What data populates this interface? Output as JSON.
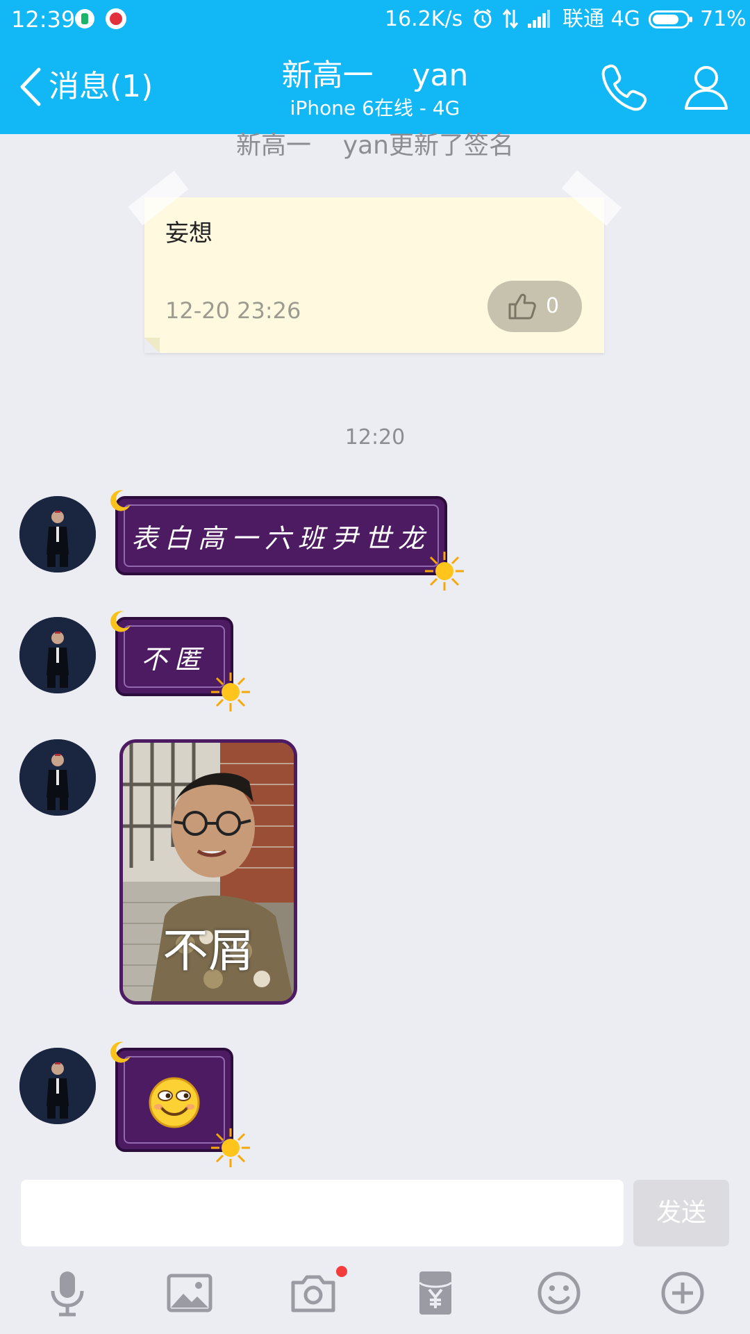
{
  "status_bar": {
    "time": "12:39",
    "speed": "16.2K/s",
    "carrier": "联通 4G",
    "battery": "71%"
  },
  "header": {
    "back_label": "消息(1)",
    "title": "新高一    yan",
    "subtitle": "iPhone 6在线 - 4G"
  },
  "chat": {
    "system_notice": "新高一    yan更新了签名",
    "signature_card": {
      "text": "妄想",
      "time": "12-20 23:26",
      "likes": "0"
    },
    "timestamp": "12:20",
    "messages": [
      {
        "type": "text",
        "text": "表白高一六班尹世龙"
      },
      {
        "type": "text",
        "text": "不匿"
      },
      {
        "type": "image",
        "caption": "不屑"
      },
      {
        "type": "emoji",
        "emoji": "smiling face"
      }
    ]
  },
  "input": {
    "placeholder": "",
    "send_label": "发送"
  },
  "toolbar": {
    "icons": [
      "microphone-icon",
      "image-icon",
      "camera-icon",
      "red-packet-icon",
      "emoji-icon",
      "plus-icon"
    ]
  },
  "colors": {
    "accent": "#12b7f5",
    "bubble": "#4d1b61",
    "background": "#ececf3",
    "card": "#fffadf",
    "notification_dot": "#f43c3c"
  }
}
